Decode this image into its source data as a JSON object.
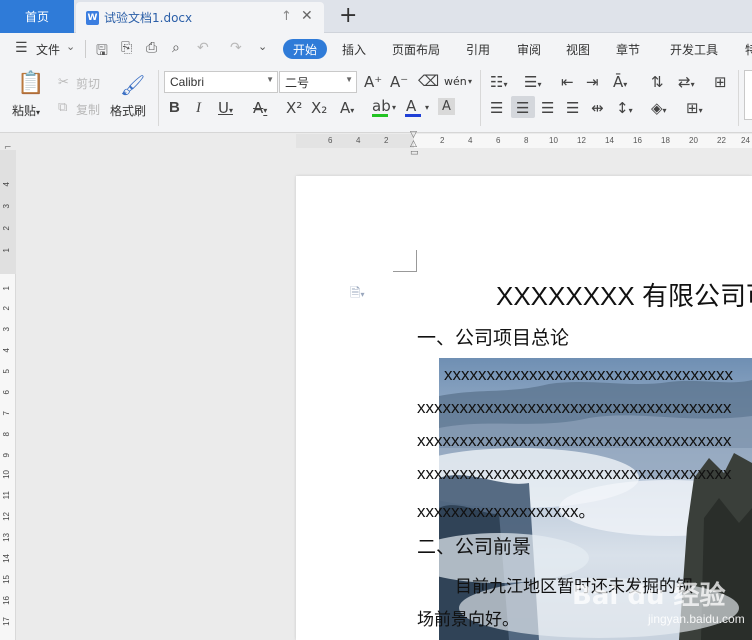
{
  "tabs": {
    "home": "首页",
    "document": "试验文档1.docx",
    "doc_logo": "W",
    "new_tab": "+"
  },
  "menu": {
    "file": "文件",
    "items": [
      "开始",
      "插入",
      "页面布局",
      "引用",
      "审阅",
      "视图",
      "章节",
      "开发工具",
      "特"
    ]
  },
  "ribbon": {
    "paste": "粘贴",
    "cut": "剪切",
    "copy": "复制",
    "format_painter": "格式刷",
    "font_name": "Calibri",
    "font_size": "二号",
    "bold": "B",
    "italic": "I",
    "underline": "U",
    "strike": "A",
    "superscript": "X²",
    "subscript": "X₂",
    "font_effect": "A",
    "highlight": "ab",
    "font_color": "A",
    "char_shade": "A",
    "grow_font": "A⁺",
    "shrink_font": "A⁻",
    "phonetic": "wén",
    "highlight_color": "#22c322",
    "font_color_value": "#1f3fd6",
    "accent_color": "#2f7bd8"
  },
  "ruler": {
    "h_ticks": [
      "6",
      "4",
      "2",
      "2",
      "4",
      "6",
      "8",
      "10",
      "12",
      "14",
      "16",
      "18",
      "20",
      "22",
      "24",
      "26"
    ],
    "v_ticks": [
      "4",
      "3",
      "2",
      "1",
      "1",
      "2",
      "3",
      "4",
      "5",
      "6",
      "7",
      "8",
      "9",
      "10",
      "11",
      "12",
      "13",
      "14",
      "15",
      "16",
      "17",
      "18"
    ]
  },
  "document": {
    "title": "XXXXXXXX 有限公司可",
    "heading1": "一、公司项目总论",
    "para_line1": "xxxxxxxxxxxxxxxxxxxxxxxxxxxxxxxxxx",
    "para_line2": "xxxxxxxxxxxxxxxxxxxxxxxxxxxxxxxxxxxxx",
    "para_line3": "xxxxxxxxxxxxxxxxxxxxxxxxxxxxxxxxxxxxx",
    "para_line4": "xxxxxxxxxxxxxxxxxxxxxxxxxxxxxxxxxxxxx",
    "para_line5": "xxxxxxxxxxxxxxxxxxx。",
    "heading2": "二、公司前景",
    "para2_line1": "目前九江地区暂时还未发掘的钡",
    "para2_line2": "场前景向好。"
  },
  "watermark": {
    "brand": "Bai du 经验",
    "url": "jingyan.baidu.com"
  }
}
